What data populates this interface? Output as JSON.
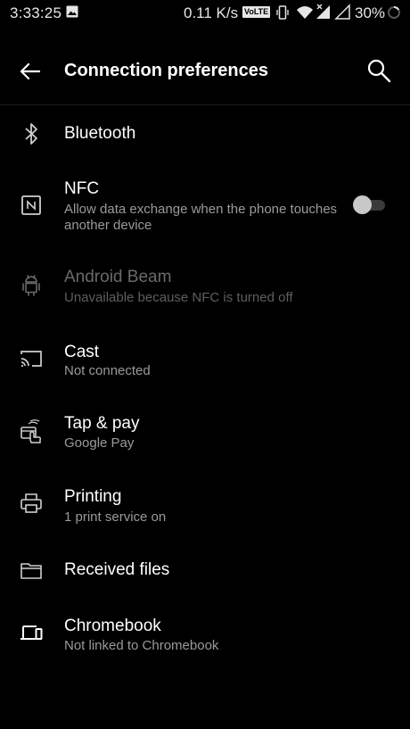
{
  "status_bar": {
    "time": "3:33:25",
    "speed": "0.11 K/s",
    "volte": "VoLTE",
    "battery": "30%",
    "icons": [
      "gallery-icon",
      "vibrate-icon",
      "wifi-icon",
      "signal-icon",
      "battery-icon"
    ]
  },
  "app_bar": {
    "title": "Connection preferences",
    "back_icon": "back-arrow-icon",
    "search_icon": "search-icon"
  },
  "items": [
    {
      "title": "Bluetooth",
      "summary": "",
      "icon": "bluetooth-icon",
      "enabled": true
    },
    {
      "title": "NFC",
      "summary": "Allow data exchange when the phone touches another device",
      "icon": "nfc-icon",
      "enabled": true,
      "toggle": false
    },
    {
      "title": "Android Beam",
      "summary": "Unavailable because NFC is turned off",
      "icon": "android-icon",
      "enabled": false
    },
    {
      "title": "Cast",
      "summary": "Not connected",
      "icon": "cast-icon",
      "enabled": true
    },
    {
      "title": "Tap & pay",
      "summary": "Google Pay",
      "icon": "tap-pay-icon",
      "enabled": true
    },
    {
      "title": "Printing",
      "summary": "1 print service on",
      "icon": "printer-icon",
      "enabled": true
    },
    {
      "title": "Received files",
      "summary": "",
      "icon": "folder-icon",
      "enabled": true
    },
    {
      "title": "Chromebook",
      "summary": "Not linked to Chromebook",
      "icon": "chromebook-icon",
      "enabled": true
    }
  ],
  "colors": {
    "background": "#000000",
    "primary_text": "#ffffff",
    "secondary_text": "#9a9a9a",
    "disabled_text": "#6a6a6a"
  }
}
